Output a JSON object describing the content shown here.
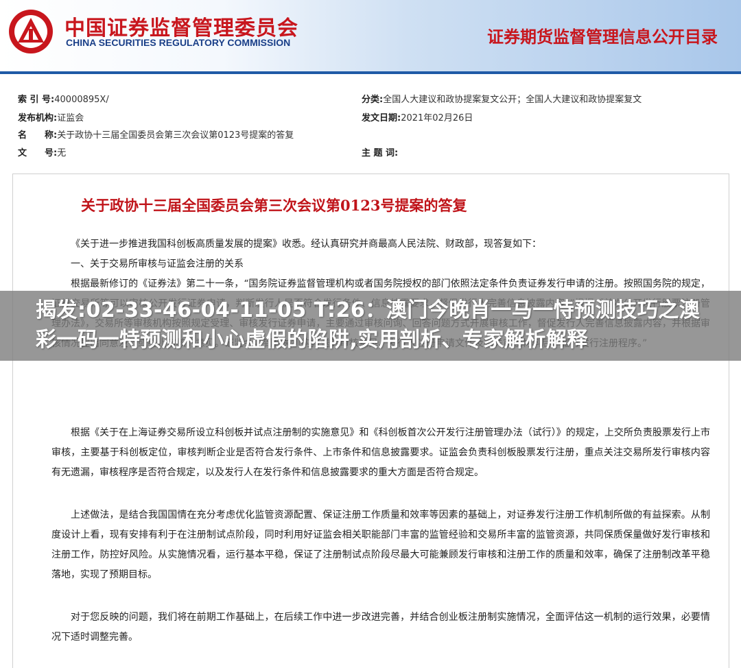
{
  "header": {
    "org_cn": "中国证券监督管理委员会",
    "org_en": "CHINA SECURITIES REGULATORY COMMISSION",
    "right_title": "证券期货监督管理信息公开目录"
  },
  "meta": {
    "index_label": "索 引 号:",
    "index_value": "40000895X/",
    "category_label": "分类:",
    "category_value": "全国人大建议和政协提案复文公开；全国人大建议和政协提案复文",
    "issuer_label": "发布机构:",
    "issuer_value": "证监会",
    "date_label": "发文日期:",
    "date_value": "2021年02月26日",
    "name_label_1": "名",
    "name_label_2": "称:",
    "name_value": "关于政协十三届全国委员会第三次会议第0123号提案的答复",
    "doc_no_label_1": "文",
    "doc_no_label_2": "号:",
    "doc_no_value": "无",
    "subject_label": "主 题 词:",
    "subject_value": ""
  },
  "document": {
    "title": "关于政协十三届全国委员会第三次会议第0123号提案的答复",
    "p1": "《关于进一步推进我国科创板高质量发展的提案》收悉。经认真研究并商最高人民法院、财政部，现答复如下：",
    "p2": "一、关于交易所审核与证监会注册的关系",
    "p3": "根据最新修订的《证券法》第二十一条，“国务院证券监督管理机构或者国务院授权的部门依照法定条件负责证券发行申请的注册。按照国务院的规定，证券交易所等可以审核公开发行证券申请，判断发行人是否符合发行条件、信息披露要求，督促发行人完善信息披露内容。”根据《首次公开发行股票注册管理办法》，交易所等审核机构按照规定受理、审核发行证券申请，主要通过审核问询、回答问题方式开展审核工作，督促发行人完善信息披露内容，并根据审核情况提出同意发行或终止审核的意见。证监会收到有关机构报送的审核意见、发行人注册申请文件及相关审核材料后，履行发行注册程序。”",
    "p4": "根据《关于在上海证券交易所设立科创板并试点注册制的实施意见》和《科创板首次公开发行注册管理办法（试行）》的规定，上交所负责股票发行上市审核，主要基于科创板定位，审核判断企业是否符合发行条件、上市条件和信息披露要求。证监会负责科创板股票发行注册，重点关注交易所发行审核内容有无遗漏，审核程序是否符合规定，以及发行人在发行条件和信息披露要求的重大方面是否符合规定。",
    "p5": "上述做法，是结合我国国情在充分考虑优化监管资源配置、保证注册工作质量和效率等因素的基础上，对证券发行注册工作机制所做的有益探索。从制度设计上看，现有安排有利于在注册制试点阶段，同时利用好证监会相关职能部门丰富的监管经验和交易所丰富的监管资源，共同保质保量做好发行审核和注册工作，防控好风险。从实施情况看，运行基本平稳，保证了注册制试点阶段尽最大可能兼顾发行审核和注册工作的质量和效率，确保了注册制改革平稳落地，实现了预期目标。",
    "p6": "对于您反映的问题，我们将在前期工作基础上，在后续工作中进一步改进完善，并结合创业板注册制实施情况，全面评估这一机制的运行效果，必要情况下适时调整完善。"
  },
  "overlay": {
    "text": "揭发:02-33-46-04-11-05 T:26：澳门今晚肖一马一恃预测技巧之澳彩一码一特预测和小心虚假的陷阱,实用剖析、专家解析解释"
  }
}
